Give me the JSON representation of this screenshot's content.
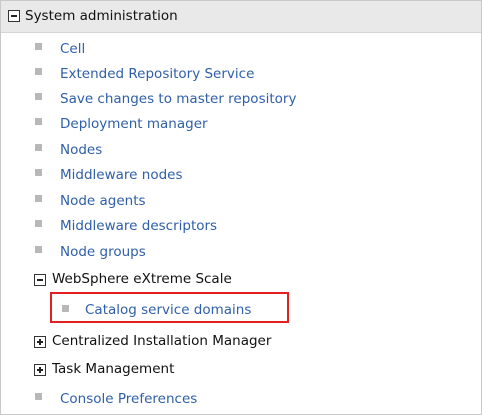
{
  "header": {
    "title": "System administration"
  },
  "items": {
    "cell": "Cell",
    "extended_repository_service": "Extended Repository Service",
    "save_changes": "Save changes to master repository",
    "deployment_manager": "Deployment manager",
    "nodes": "Nodes",
    "middleware_nodes": "Middleware nodes",
    "node_agents": "Node agents",
    "middleware_descriptors": "Middleware descriptors",
    "node_groups": "Node groups"
  },
  "websphere": {
    "label": "WebSphere eXtreme Scale",
    "children": {
      "catalog_service_domains": "Catalog service domains"
    }
  },
  "centralized_installation_manager": "Centralized Installation Manager",
  "task_management": "Task Management",
  "console_preferences": "Console Preferences",
  "colors": {
    "link": "#2e5fa8",
    "highlight": "#e31f1f",
    "header_bg": "#e9e9e9"
  }
}
